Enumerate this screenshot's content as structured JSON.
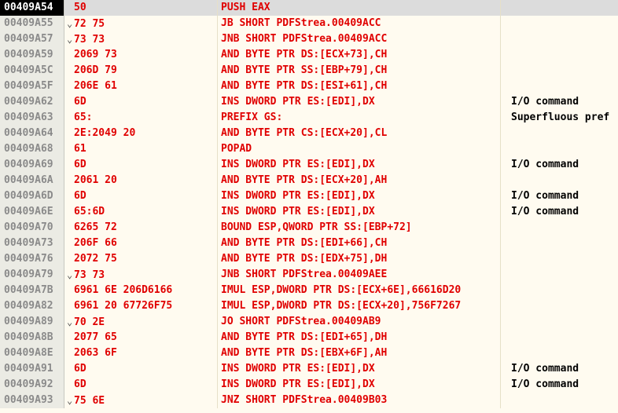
{
  "rows": [
    {
      "addr": "00409A54",
      "bytes": "50",
      "jump": false,
      "instr": "PUSH EAX",
      "comment": "",
      "selected": true
    },
    {
      "addr": "00409A55",
      "bytes": "72 75",
      "jump": true,
      "instr": "JB SHORT PDFStrea.00409ACC",
      "comment": ""
    },
    {
      "addr": "00409A57",
      "bytes": "73 73",
      "jump": true,
      "instr": "JNB SHORT PDFStrea.00409ACC",
      "comment": ""
    },
    {
      "addr": "00409A59",
      "bytes": "2069 73",
      "jump": false,
      "instr": "AND BYTE PTR DS:[ECX+73],CH",
      "comment": ""
    },
    {
      "addr": "00409A5C",
      "bytes": "206D 79",
      "jump": false,
      "instr": "AND BYTE PTR SS:[EBP+79],CH",
      "comment": ""
    },
    {
      "addr": "00409A5F",
      "bytes": "206E 61",
      "jump": false,
      "instr": "AND BYTE PTR DS:[ESI+61],CH",
      "comment": ""
    },
    {
      "addr": "00409A62",
      "bytes": "6D",
      "jump": false,
      "instr": "INS DWORD PTR ES:[EDI],DX",
      "comment": "I/O command"
    },
    {
      "addr": "00409A63",
      "bytes": "65:",
      "jump": false,
      "instr": "PREFIX GS:",
      "comment": "Superfluous pref"
    },
    {
      "addr": "00409A64",
      "bytes": "2E:2049 20",
      "jump": false,
      "instr": "AND BYTE PTR CS:[ECX+20],CL",
      "comment": ""
    },
    {
      "addr": "00409A68",
      "bytes": "61",
      "jump": false,
      "instr": "POPAD",
      "comment": ""
    },
    {
      "addr": "00409A69",
      "bytes": "6D",
      "jump": false,
      "instr": "INS DWORD PTR ES:[EDI],DX",
      "comment": "I/O command"
    },
    {
      "addr": "00409A6A",
      "bytes": "2061 20",
      "jump": false,
      "instr": "AND BYTE PTR DS:[ECX+20],AH",
      "comment": ""
    },
    {
      "addr": "00409A6D",
      "bytes": "6D",
      "jump": false,
      "instr": "INS DWORD PTR ES:[EDI],DX",
      "comment": "I/O command"
    },
    {
      "addr": "00409A6E",
      "bytes": "65:6D",
      "jump": false,
      "instr": "INS DWORD PTR ES:[EDI],DX",
      "comment": "I/O command"
    },
    {
      "addr": "00409A70",
      "bytes": "6265 72",
      "jump": false,
      "instr": "BOUND ESP,QWORD PTR SS:[EBP+72]",
      "comment": ""
    },
    {
      "addr": "00409A73",
      "bytes": "206F 66",
      "jump": false,
      "instr": "AND BYTE PTR DS:[EDI+66],CH",
      "comment": ""
    },
    {
      "addr": "00409A76",
      "bytes": "2072 75",
      "jump": false,
      "instr": "AND BYTE PTR DS:[EDX+75],DH",
      "comment": ""
    },
    {
      "addr": "00409A79",
      "bytes": "73 73",
      "jump": true,
      "instr": "JNB SHORT PDFStrea.00409AEE",
      "comment": ""
    },
    {
      "addr": "00409A7B",
      "bytes": "6961 6E 206D6166",
      "jump": false,
      "instr": "IMUL ESP,DWORD PTR DS:[ECX+6E],66616D20",
      "comment": ""
    },
    {
      "addr": "00409A82",
      "bytes": "6961 20 67726F75",
      "jump": false,
      "instr": "IMUL ESP,DWORD PTR DS:[ECX+20],756F7267",
      "comment": ""
    },
    {
      "addr": "00409A89",
      "bytes": "70 2E",
      "jump": true,
      "instr": "JO SHORT PDFStrea.00409AB9",
      "comment": ""
    },
    {
      "addr": "00409A8B",
      "bytes": "2077 65",
      "jump": false,
      "instr": "AND BYTE PTR DS:[EDI+65],DH",
      "comment": ""
    },
    {
      "addr": "00409A8E",
      "bytes": "2063 6F",
      "jump": false,
      "instr": "AND BYTE PTR DS:[EBX+6F],AH",
      "comment": ""
    },
    {
      "addr": "00409A91",
      "bytes": "6D",
      "jump": false,
      "instr": "INS DWORD PTR ES:[EDI],DX",
      "comment": "I/O command"
    },
    {
      "addr": "00409A92",
      "bytes": "6D",
      "jump": false,
      "instr": "INS DWORD PTR ES:[EDI],DX",
      "comment": "I/O command"
    },
    {
      "addr": "00409A93",
      "bytes": "75 6E",
      "jump": true,
      "instr": "JNZ SHORT PDFStrea.00409B03",
      "comment": ""
    }
  ],
  "jump_arrow_glyph": "⌄",
  "colors": {
    "address_text": "#8a8a8a",
    "address_bg": "#ebebe4",
    "selected_address_bg": "#000000",
    "selected_address_text": "#ffffff",
    "selected_row_bg": "#dcdcdc",
    "code_text": "#e00000",
    "comment_text": "#000000",
    "pane_bg": "#fffbf0"
  }
}
